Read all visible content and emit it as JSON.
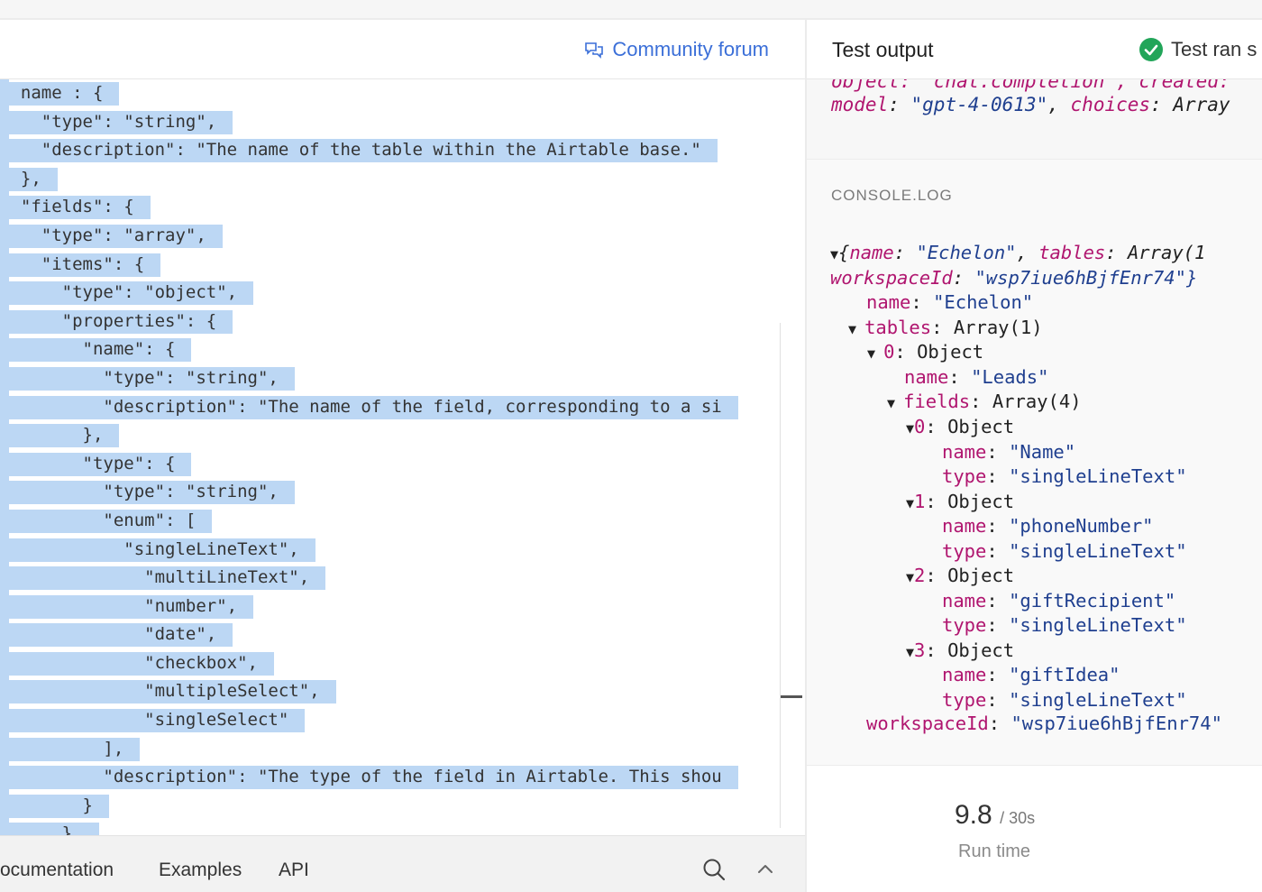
{
  "header": {
    "community_forum": "Community forum",
    "test_output": "Test output",
    "test_status": "Test ran s"
  },
  "editor": {
    "lines": [
      "  name : {",
      "    \"type\": \"string\",",
      "    \"description\": \"The name of the table within the Airtable base.\"",
      "  },",
      "  \"fields\": {",
      "    \"type\": \"array\",",
      "    \"items\": {",
      "      \"type\": \"object\",",
      "      \"properties\": {",
      "        \"name\": {",
      "          \"type\": \"string\",",
      "          \"description\": \"The name of the field, corresponding to a si",
      "        },",
      "        \"type\": {",
      "          \"type\": \"string\",",
      "          \"enum\": [",
      "            \"singleLineText\",",
      "              \"multiLineText\",",
      "              \"number\",",
      "              \"date\",",
      "              \"checkbox\",",
      "              \"multipleSelect\",",
      "              \"singleSelect\"",
      "          ],",
      "          \"description\": \"The type of the field in Airtable. This shou",
      "        }",
      "      },"
    ]
  },
  "footer": {
    "tabs": [
      "ocumentation",
      "Examples",
      "API"
    ],
    "icons": [
      "search-icon",
      "chevron-up-icon"
    ]
  },
  "output": {
    "line1": "object: \"chat.completion\", created:",
    "line2_key1": "model",
    "line2_val1": "\"gpt-4-0613\"",
    "line2_key2": "choices",
    "line2_val2": "Array"
  },
  "console": {
    "label": "CONSOLE.LOG",
    "root_k1": "name",
    "root_v1": "\"Echelon\"",
    "root_k2": "tables",
    "root_v2": "Array(1",
    "root_k3": "workspaceId",
    "root_v3": "\"wsp7iue6hBjfEnr74\"}",
    "name_key": "name",
    "name_val": "\"Echelon\"",
    "tables_key": "tables",
    "tables_val": "Array(1)",
    "t0_key": "0",
    "t0_val": "Object",
    "t0_name_key": "name",
    "t0_name_val": "\"Leads\"",
    "fields_key": "fields",
    "fields_val": "Array(4)",
    "fields": [
      {
        "index": "0",
        "obj": "Object",
        "name_key": "name",
        "name": "\"Name\"",
        "type_key": "type",
        "type": "\"singleLineText\""
      },
      {
        "index": "1",
        "obj": "Object",
        "name_key": "name",
        "name": "\"phoneNumber\"",
        "type_key": "type",
        "type": "\"singleLineText\""
      },
      {
        "index": "2",
        "obj": "Object",
        "name_key": "name",
        "name": "\"giftRecipient\"",
        "type_key": "type",
        "type": "\"singleLineText\""
      },
      {
        "index": "3",
        "obj": "Object",
        "name_key": "name",
        "name": "\"giftIdea\"",
        "type_key": "type",
        "type": "\"singleLineText\""
      }
    ],
    "ws_key": "workspaceId",
    "ws_val": "\"wsp7iue6hBjfEnr74\""
  },
  "runtime": {
    "value": "9.8",
    "total": "/ 30s",
    "label": "Run time"
  },
  "colors": {
    "accent": "#3b6fd8",
    "selection": "#bcd7f4",
    "key": "#b0156f",
    "string": "#1f3f8f",
    "success": "#22a559"
  }
}
